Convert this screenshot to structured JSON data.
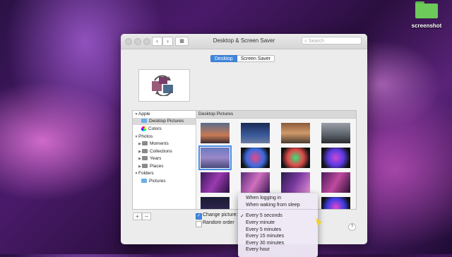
{
  "desktop": {
    "folder_label": "screenshot",
    "folder_color": "#6cc95a"
  },
  "window": {
    "title": "Desktop & Screen Saver",
    "search_placeholder": "Search",
    "nav_back": "‹",
    "nav_forward": "›",
    "tabs": [
      {
        "label": "Desktop",
        "active": true
      },
      {
        "label": "Screen Saver",
        "active": false
      }
    ]
  },
  "sidebar": {
    "items": [
      {
        "label": "Apple",
        "type": "group",
        "expanded": true
      },
      {
        "label": "Desktop Pictures",
        "type": "folder",
        "selected": true
      },
      {
        "label": "Colors",
        "type": "colors"
      },
      {
        "label": "Photos",
        "type": "group",
        "expanded": true
      },
      {
        "label": "Moments",
        "type": "album"
      },
      {
        "label": "Collections",
        "type": "album"
      },
      {
        "label": "Years",
        "type": "album"
      },
      {
        "label": "Places",
        "type": "album"
      },
      {
        "label": "Folders",
        "type": "group",
        "expanded": true
      },
      {
        "label": "Pictures",
        "type": "folder"
      }
    ]
  },
  "content": {
    "header": "Desktop Pictures"
  },
  "footer": {
    "add_label": "+",
    "remove_label": "−",
    "change_picture_label": "Change picture:",
    "change_picture_checked": true,
    "random_order_label": "Random order",
    "random_order_checked": false,
    "help_label": "?"
  },
  "menu": {
    "items": [
      {
        "label": "When logging in",
        "checked": false
      },
      {
        "label": "When waking from sleep",
        "checked": false
      },
      {
        "label": "Every 5 seconds",
        "checked": true
      },
      {
        "label": "Every minute",
        "checked": false
      },
      {
        "label": "Every 5 minutes",
        "checked": false
      },
      {
        "label": "Every 15 minutes",
        "checked": false
      },
      {
        "label": "Every 30 minutes",
        "checked": false
      },
      {
        "label": "Every hour",
        "checked": false
      }
    ],
    "check_glyph": "✓"
  },
  "colors": {
    "accent": "#3f86e0"
  }
}
